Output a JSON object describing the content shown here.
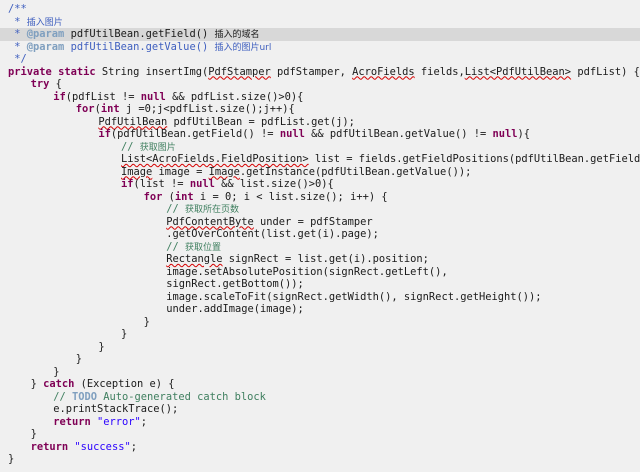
{
  "lines": [
    {
      "indent": 0,
      "hl": "",
      "tokens": [
        {
          "c": "jd",
          "t": "/**"
        }
      ]
    },
    {
      "indent": 0,
      "hl": "",
      "tokens": [
        {
          "c": "jd",
          "t": " * "
        },
        {
          "c": "jd cjk",
          "t": "插入图片"
        }
      ]
    },
    {
      "indent": 0,
      "hl": "hl2",
      "tokens": [
        {
          "c": "jd",
          "t": " * "
        },
        {
          "c": "tag",
          "t": "@param"
        },
        {
          "c": "",
          "t": " pdfUtilBean.getField() "
        },
        {
          "c": "cjk",
          "t": "插入的域名"
        }
      ]
    },
    {
      "indent": 0,
      "hl": "",
      "tokens": [
        {
          "c": "jd",
          "t": " * "
        },
        {
          "c": "tag",
          "t": "@param"
        },
        {
          "c": "jd",
          "t": " pdfUtilBean.getValue() "
        },
        {
          "c": "jd cjk",
          "t": "插入的图片url"
        }
      ]
    },
    {
      "indent": 0,
      "hl": "",
      "tokens": [
        {
          "c": "jd",
          "t": " */"
        }
      ]
    },
    {
      "indent": 0,
      "hl": "",
      "tokens": [
        {
          "c": "kw",
          "t": "private"
        },
        {
          "c": "",
          "t": " "
        },
        {
          "c": "kw",
          "t": "static"
        },
        {
          "c": "",
          "t": " String insertImg("
        },
        {
          "c": "ul",
          "t": "PdfStamper"
        },
        {
          "c": "",
          "t": " pdfStamper, "
        },
        {
          "c": "ul",
          "t": "AcroFields"
        },
        {
          "c": "",
          "t": " fields,"
        },
        {
          "c": "ul",
          "t": "List<PdfUtilBean>"
        },
        {
          "c": "",
          "t": " pdfList) {"
        }
      ]
    },
    {
      "indent": 1,
      "hl": "",
      "tokens": [
        {
          "c": "kw",
          "t": "try"
        },
        {
          "c": "",
          "t": " {"
        }
      ]
    },
    {
      "indent": 2,
      "hl": "",
      "tokens": [
        {
          "c": "kw",
          "t": "if"
        },
        {
          "c": "",
          "t": "(pdfList != "
        },
        {
          "c": "kw",
          "t": "null"
        },
        {
          "c": "",
          "t": " && pdfList.size()>0){"
        }
      ]
    },
    {
      "indent": 3,
      "hl": "",
      "tokens": [
        {
          "c": "kw",
          "t": "for"
        },
        {
          "c": "",
          "t": "("
        },
        {
          "c": "kw",
          "t": "int"
        },
        {
          "c": "",
          "t": " j =0;j<pdfList.size();j++){"
        }
      ]
    },
    {
      "indent": 4,
      "hl": "",
      "tokens": [
        {
          "c": "ul",
          "t": "PdfUtilBean"
        },
        {
          "c": "",
          "t": " pdfUtilBean = pdfList.get(j);"
        }
      ]
    },
    {
      "indent": 4,
      "hl": "",
      "tokens": [
        {
          "c": "kw",
          "t": "if"
        },
        {
          "c": "",
          "t": "(pdfUtilBean.getField() != "
        },
        {
          "c": "kw",
          "t": "null"
        },
        {
          "c": "",
          "t": " && pdfUtilBean.getValue() != "
        },
        {
          "c": "kw",
          "t": "null"
        },
        {
          "c": "",
          "t": "){"
        }
      ]
    },
    {
      "indent": 5,
      "hl": "",
      "tokens": [
        {
          "c": "cm",
          "t": "// "
        },
        {
          "c": "cm cjk",
          "t": "获取图片"
        }
      ]
    },
    {
      "indent": 5,
      "hl": "",
      "tokens": [
        {
          "c": "ul",
          "t": "List<AcroFields.FieldPosition>"
        },
        {
          "c": "",
          "t": " list = fields.getFieldPositions(pdfUtilBean.getField());"
        }
      ]
    },
    {
      "indent": 5,
      "hl": "",
      "tokens": [
        {
          "c": "ul",
          "t": "Image"
        },
        {
          "c": "",
          "t": " image = "
        },
        {
          "c": "ul",
          "t": "Image"
        },
        {
          "c": "",
          "t": ".getInstance(pdfUtilBean.getValue());"
        }
      ]
    },
    {
      "indent": 5,
      "hl": "",
      "tokens": [
        {
          "c": "kw",
          "t": "if"
        },
        {
          "c": "",
          "t": "(list != "
        },
        {
          "c": "kw",
          "t": "null"
        },
        {
          "c": "",
          "t": " && list.size()>0){"
        }
      ]
    },
    {
      "indent": 6,
      "hl": "",
      "tokens": [
        {
          "c": "kw",
          "t": "for"
        },
        {
          "c": "",
          "t": " ("
        },
        {
          "c": "kw",
          "t": "int"
        },
        {
          "c": "",
          "t": " i = 0; i < list.size(); i++) {"
        }
      ]
    },
    {
      "indent": 7,
      "hl": "",
      "tokens": [
        {
          "c": "cm",
          "t": "// "
        },
        {
          "c": "cm cjk",
          "t": "获取所在页数"
        }
      ]
    },
    {
      "indent": 7,
      "hl": "",
      "tokens": [
        {
          "c": "ul",
          "t": "PdfContentByte"
        },
        {
          "c": "",
          "t": " under = pdfStamper"
        }
      ]
    },
    {
      "indent": 7,
      "hl": "",
      "tokens": [
        {
          "c": "",
          "t": ".getOverContent(list.get(i).page);"
        }
      ]
    },
    {
      "indent": 7,
      "hl": "",
      "tokens": [
        {
          "c": "cm",
          "t": "// "
        },
        {
          "c": "cm cjk",
          "t": "获取位置"
        }
      ]
    },
    {
      "indent": 7,
      "hl": "",
      "tokens": [
        {
          "c": "ul",
          "t": "Rectangle"
        },
        {
          "c": "",
          "t": " signRect = list.get(i).position;"
        }
      ]
    },
    {
      "indent": 7,
      "hl": "",
      "tokens": [
        {
          "c": "",
          "t": "image.setAbsolutePosition(signRect.getLeft(),"
        }
      ]
    },
    {
      "indent": 7,
      "hl": "",
      "tokens": [
        {
          "c": "",
          "t": "signRect.getBottom());"
        }
      ]
    },
    {
      "indent": 7,
      "hl": "",
      "tokens": [
        {
          "c": "",
          "t": "image.scaleToFit(signRect.getWidth(), signRect.getHeight());"
        }
      ]
    },
    {
      "indent": 7,
      "hl": "",
      "tokens": [
        {
          "c": "",
          "t": "under.addImage(image);"
        }
      ]
    },
    {
      "indent": 6,
      "hl": "",
      "tokens": [
        {
          "c": "",
          "t": "}"
        }
      ]
    },
    {
      "indent": 5,
      "hl": "",
      "tokens": [
        {
          "c": "",
          "t": "}"
        }
      ]
    },
    {
      "indent": 4,
      "hl": "",
      "tokens": [
        {
          "c": "",
          "t": "}"
        }
      ]
    },
    {
      "indent": 3,
      "hl": "",
      "tokens": [
        {
          "c": "",
          "t": "}"
        }
      ]
    },
    {
      "indent": 2,
      "hl": "",
      "tokens": [
        {
          "c": "",
          "t": "}"
        }
      ]
    },
    {
      "indent": 1,
      "hl": "",
      "tokens": [
        {
          "c": "",
          "t": "} "
        },
        {
          "c": "kw",
          "t": "catch"
        },
        {
          "c": "",
          "t": " (Exception e) {"
        }
      ]
    },
    {
      "indent": 2,
      "hl": "",
      "tokens": [
        {
          "c": "cm",
          "t": "// "
        },
        {
          "c": "todo",
          "t": "TODO"
        },
        {
          "c": "cm",
          "t": " Auto-generated catch block"
        }
      ]
    },
    {
      "indent": 2,
      "hl": "",
      "tokens": [
        {
          "c": "",
          "t": "e.printStackTrace();"
        }
      ]
    },
    {
      "indent": 2,
      "hl": "",
      "tokens": [
        {
          "c": "kw",
          "t": "return"
        },
        {
          "c": "",
          "t": " "
        },
        {
          "c": "str",
          "t": "\"error\""
        },
        {
          "c": "",
          "t": ";"
        }
      ]
    },
    {
      "indent": 1,
      "hl": "",
      "tokens": [
        {
          "c": "",
          "t": "}"
        }
      ]
    },
    {
      "indent": 1,
      "hl": "",
      "tokens": [
        {
          "c": "kw",
          "t": "return"
        },
        {
          "c": "",
          "t": " "
        },
        {
          "c": "str",
          "t": "\"success\""
        },
        {
          "c": "",
          "t": ";"
        }
      ]
    },
    {
      "indent": 0,
      "hl": "",
      "tokens": [
        {
          "c": "",
          "t": "}"
        }
      ]
    }
  ]
}
